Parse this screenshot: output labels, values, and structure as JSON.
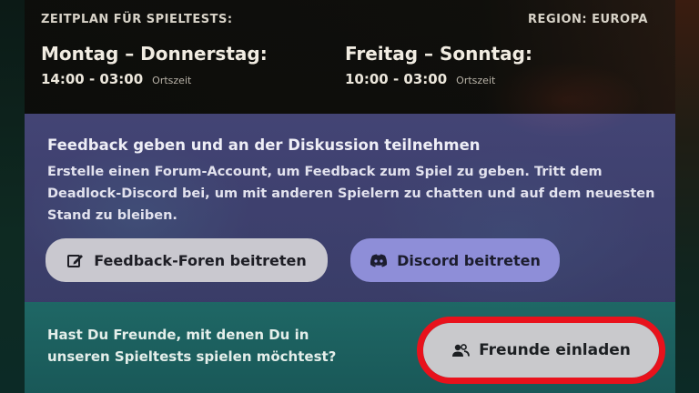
{
  "schedule": {
    "header_left": "ZEITPLAN FÜR SPIELTESTS:",
    "header_right": "REGION: EUROPA",
    "days": [
      {
        "title": "Montag – Donnerstag:",
        "time": "14:00 - 03:00",
        "note": "Ortszeit"
      },
      {
        "title": "Freitag – Sonntag:",
        "time": "10:00 - 03:00",
        "note": "Ortszeit"
      }
    ]
  },
  "feedback": {
    "title": "Feedback geben und an der Diskussion teilnehmen",
    "text": "Erstelle einen Forum-Account, um Feedback zum Spiel zu geben. Tritt dem Deadlock-Discord bei, um mit anderen Spielern zu chatten und auf dem neuesten Stand zu bleiben.",
    "forum_button": {
      "label": "Feedback-Foren beitreten",
      "icon": "edit-icon"
    },
    "discord_button": {
      "label": "Discord beitreten",
      "icon": "discord-icon"
    }
  },
  "invite": {
    "text": "Hast Du Freunde, mit denen Du in unseren Spieltests spielen möchtest?",
    "button": {
      "label": "Freunde einladen",
      "icon": "friends-icon"
    },
    "highlight_color": "#e8121c"
  }
}
